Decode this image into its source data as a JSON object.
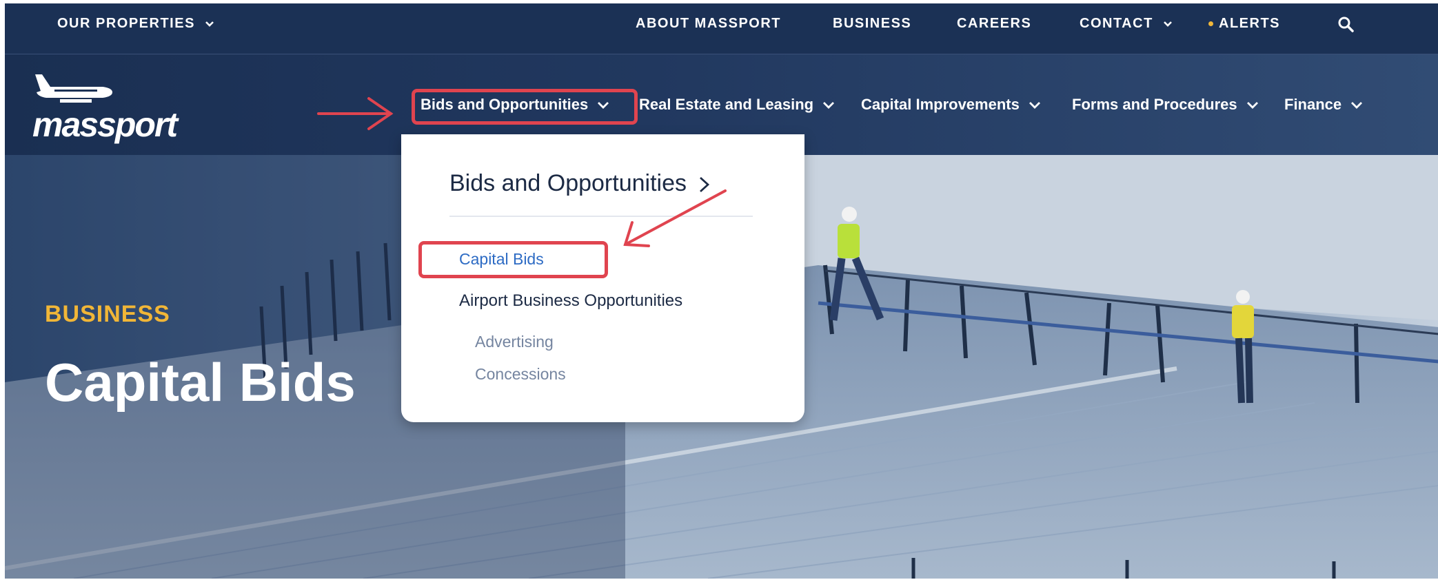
{
  "utility_nav": {
    "our_properties": "OUR PROPERTIES",
    "about": "ABOUT MASSPORT",
    "business": "BUSINESS",
    "careers": "CAREERS",
    "contact": "CONTACT",
    "alerts": "ALERTS",
    "search_icon": "search-icon"
  },
  "logo": {
    "wordmark": "massport"
  },
  "main_nav": {
    "items": [
      "Bids and Opportunities",
      "Real Estate and Leasing",
      "Capital Improvements",
      "Forms and Procedures",
      "Finance"
    ]
  },
  "dropdown": {
    "heading": "Bids and Opportunities",
    "links": {
      "capital_bids": "Capital Bids",
      "airport_business": "Airport Business Opportunities",
      "advertising": "Advertising",
      "concessions": "Concessions"
    }
  },
  "hero": {
    "eyebrow": "BUSINESS",
    "title": "Capital Bids"
  },
  "colors": {
    "nav_background": "#1b3155",
    "accent_gold": "#f1b637",
    "link_blue": "#2d6bc4",
    "annotation_red": "#e0444f"
  }
}
